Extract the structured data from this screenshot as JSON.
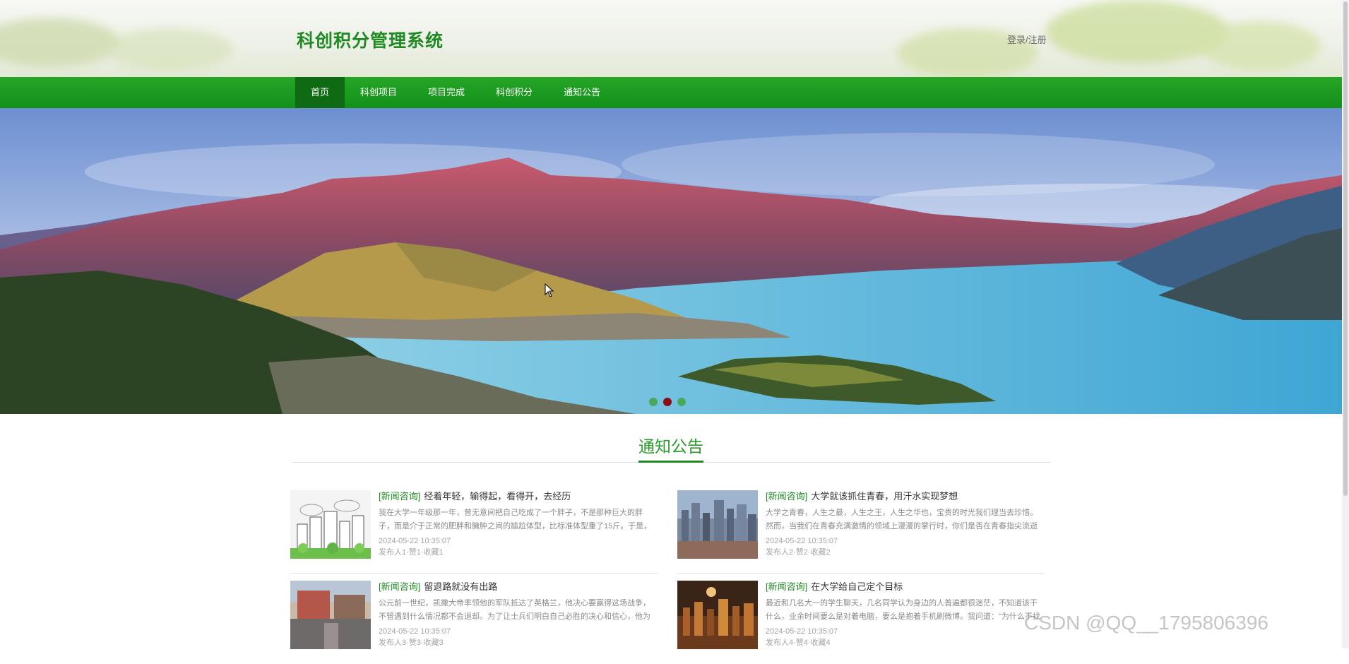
{
  "header": {
    "site_title": "科创积分管理系统",
    "login_link": "登录/注册"
  },
  "nav": {
    "items": [
      {
        "label": "首页",
        "active": true
      },
      {
        "label": "科创项目",
        "active": false
      },
      {
        "label": "项目完成",
        "active": false
      },
      {
        "label": "科创积分",
        "active": false
      },
      {
        "label": "通知公告",
        "active": false
      }
    ]
  },
  "banner": {
    "slide_count": 3,
    "active_slide": 2
  },
  "notices": {
    "section_title": "通知公告",
    "items": [
      {
        "tag": "[新闻咨询]",
        "title": "经着年轻，输得起，看得开，去经历",
        "summary": "我在大学一年级那一年，曾无意间把自己吃成了一个胖子，不是那种巨大的胖子，而是介于正常的肥胖和臃肿之间的尴尬体型，比标准体型重了15斤。于是，我的整个",
        "date": "2024-05-22 10:35:07",
        "stats": "发布人1·赞1·收藏1",
        "thumbnail": "city-sketch"
      },
      {
        "tag": "[新闻咨询]",
        "title": "大学就该抓住青春，用汗水实现梦想",
        "summary": "大学之青春，人生之最，人生之王，人生之华也，宝贵的时光我们理当去珍惜。然而，当我们在青春充满激情的领域上漫漫的掌行时，你们是否在青春指尖流逝的瞬间上",
        "date": "2024-05-22 10:35:07",
        "stats": "发布人2·赞2·收藏2",
        "thumbnail": "city-skyline"
      },
      {
        "tag": "[新闻咨询]",
        "title": "留退路就没有出路",
        "summary": "公元前一世纪，凯撒大帝率领他的军队抵达了英格兰，他决心要赢得这场战争，不管遇到什么情况都不会退却。为了让士兵们明白自己必胜的决心和信心，他为了断绝士",
        "date": "2024-05-22 10:35:07",
        "stats": "发布人3·赞3·收藏3",
        "thumbnail": "street-scene"
      },
      {
        "tag": "[新闻咨询]",
        "title": "在大学给自己定个目标",
        "summary": "最近和几名大一的学生聊天，几名同学认为身边的人普遍都很迷茫，不知道该干什么，业余时间要么是对着电脑，要么是抱着手机刷微博。我问道：\"为什么不找点事情",
        "date": "2024-05-22 10:35:07",
        "stats": "发布人4·赞4·收藏4",
        "thumbnail": "night-city"
      }
    ]
  },
  "watermark": "CSDN @QQ__1795806396",
  "colors": {
    "brand_green": "#1f8a22",
    "nav_green": "#1a9a1f",
    "nav_active": "#0f6a14",
    "dot_active": "#8a0f12"
  }
}
